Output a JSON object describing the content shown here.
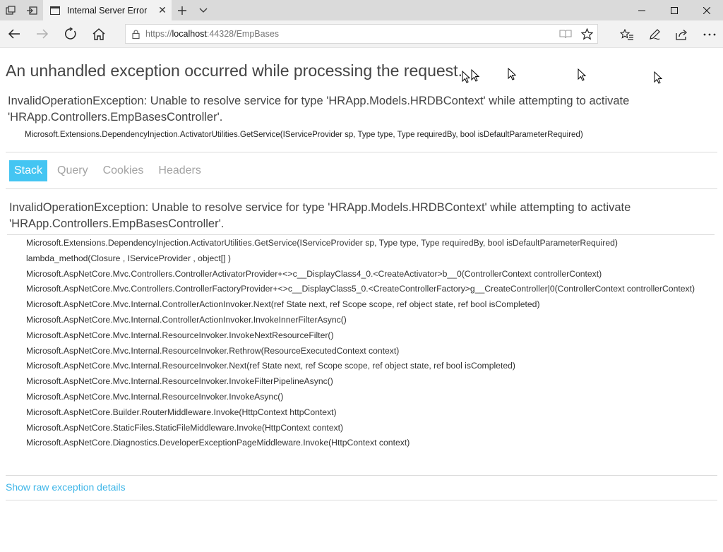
{
  "browser": {
    "tab_title": "Internal Server Error",
    "url_prefix": "https://",
    "url_host": "localhost",
    "url_rest": ":44328/EmpBases"
  },
  "page": {
    "heading": "An unhandled exception occurred while processing the request.",
    "error_message": "InvalidOperationException: Unable to resolve service for type 'HRApp.Models.HRDBContext' while attempting to activate 'HRApp.Controllers.EmpBasesController'.",
    "error_location": "Microsoft.Extensions.DependencyInjection.ActivatorUtilities.GetService(IServiceProvider sp, Type type, Type requiredBy, bool isDefaultParameterRequired)",
    "tabs": [
      "Stack",
      "Query",
      "Cookies",
      "Headers"
    ],
    "active_tab": "Stack",
    "stack": {
      "message": "InvalidOperationException: Unable to resolve service for type 'HRApp.Models.HRDBContext' while attempting to activate 'HRApp.Controllers.EmpBasesController'.",
      "frames": [
        "Microsoft.Extensions.DependencyInjection.ActivatorUtilities.GetService(IServiceProvider sp, Type type, Type requiredBy, bool isDefaultParameterRequired)",
        "lambda_method(Closure , IServiceProvider , object[] )",
        "Microsoft.AspNetCore.Mvc.Controllers.ControllerActivatorProvider+<>c__DisplayClass4_0.<CreateActivator>b__0(ControllerContext controllerContext)",
        "Microsoft.AspNetCore.Mvc.Controllers.ControllerFactoryProvider+<>c__DisplayClass5_0.<CreateControllerFactory>g__CreateController|0(ControllerContext controllerContext)",
        "Microsoft.AspNetCore.Mvc.Internal.ControllerActionInvoker.Next(ref State next, ref Scope scope, ref object state, ref bool isCompleted)",
        "Microsoft.AspNetCore.Mvc.Internal.ControllerActionInvoker.InvokeInnerFilterAsync()",
        "Microsoft.AspNetCore.Mvc.Internal.ResourceInvoker.InvokeNextResourceFilter()",
        "Microsoft.AspNetCore.Mvc.Internal.ResourceInvoker.Rethrow(ResourceExecutedContext context)",
        "Microsoft.AspNetCore.Mvc.Internal.ResourceInvoker.Next(ref State next, ref Scope scope, ref object state, ref bool isCompleted)",
        "Microsoft.AspNetCore.Mvc.Internal.ResourceInvoker.InvokeFilterPipelineAsync()",
        "Microsoft.AspNetCore.Mvc.Internal.ResourceInvoker.InvokeAsync()",
        "Microsoft.AspNetCore.Builder.RouterMiddleware.Invoke(HttpContext httpContext)",
        "Microsoft.AspNetCore.StaticFiles.StaticFileMiddleware.Invoke(HttpContext context)",
        "Microsoft.AspNetCore.Diagnostics.DeveloperExceptionPageMiddleware.Invoke(HttpContext context)"
      ]
    },
    "raw_link": "Show raw exception details"
  },
  "colors": {
    "accent": "#44c5f2",
    "link": "#3fb6e8"
  }
}
